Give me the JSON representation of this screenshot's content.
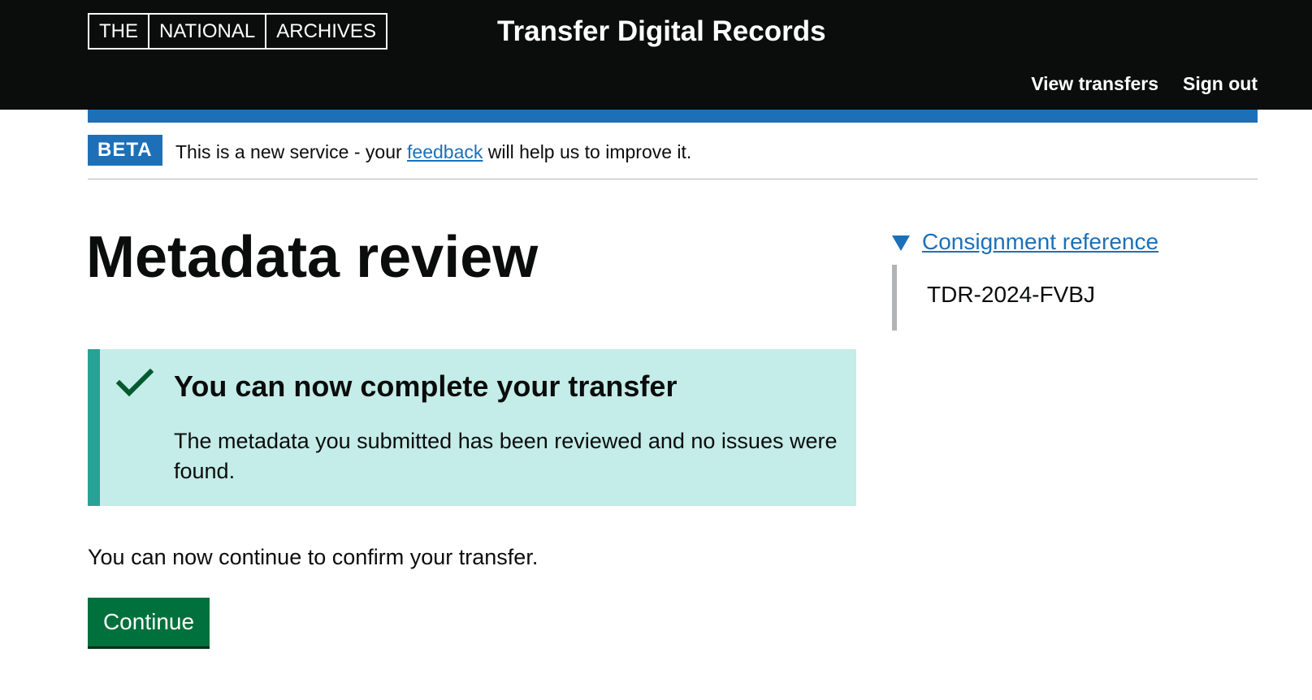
{
  "header": {
    "logo_parts": [
      "THE",
      "NATIONAL",
      "ARCHIVES"
    ],
    "service_name": "Transfer Digital Records",
    "nav": {
      "view_transfers": "View transfers",
      "sign_out": "Sign out"
    }
  },
  "phase_banner": {
    "tag": "BETA",
    "text_before": "This is a new service - your ",
    "link": "feedback",
    "text_after": " will help us to improve it."
  },
  "main": {
    "title": "Metadata review",
    "notification": {
      "heading": "You can now complete your transfer",
      "body": "The metadata you submitted has been reviewed and no issues were found."
    },
    "body_text": "You can now continue to confirm your transfer.",
    "continue_label": "Continue"
  },
  "sidebar": {
    "summary": "Consignment reference",
    "value": "TDR-2024-FVBJ"
  },
  "colors": {
    "header_bg": "#0b0c0c",
    "brand_blue": "#1d70b8",
    "success_green": "#00703c",
    "notification_bg": "#c4ece8",
    "notification_border": "#28a197"
  },
  "icons": {
    "notification": "check-icon",
    "details": "triangle-down-icon"
  }
}
